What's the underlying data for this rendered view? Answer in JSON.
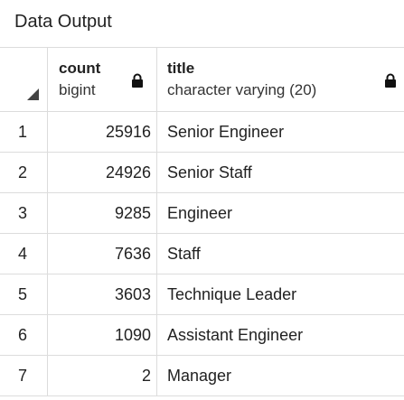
{
  "panel": {
    "title": "Data Output"
  },
  "columns": [
    {
      "name": "count",
      "type": "bigint"
    },
    {
      "name": "title",
      "type": "character varying (20)"
    }
  ],
  "rows": [
    {
      "idx": "1",
      "count": "25916",
      "title": "Senior Engineer"
    },
    {
      "idx": "2",
      "count": "24926",
      "title": "Senior Staff"
    },
    {
      "idx": "3",
      "count": "9285",
      "title": "Engineer"
    },
    {
      "idx": "4",
      "count": "7636",
      "title": "Staff"
    },
    {
      "idx": "5",
      "count": "3603",
      "title": "Technique Leader"
    },
    {
      "idx": "6",
      "count": "1090",
      "title": "Assistant Engineer"
    },
    {
      "idx": "7",
      "count": "2",
      "title": "Manager"
    }
  ],
  "icons": {
    "lock": "lock-icon",
    "sort_corner": "sort-corner-icon"
  },
  "colors": {
    "grid_line": "#dcdcdc",
    "text": "#222222"
  }
}
